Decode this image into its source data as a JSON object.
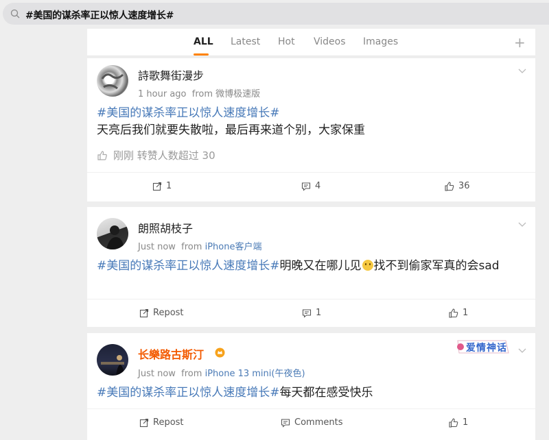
{
  "search": {
    "query": "#美国的谋杀率正以惊人速度增长#"
  },
  "tabs": [
    {
      "label": "ALL"
    },
    {
      "label": "Latest"
    },
    {
      "label": "Hot"
    },
    {
      "label": "Videos"
    },
    {
      "label": "Images"
    }
  ],
  "tab_add": "+",
  "posts": [
    {
      "author": "詩歌舞街漫步",
      "time": "1 hour ago",
      "from_label": "from",
      "source": "微博极速版",
      "hashtag": "#美国的谋杀率正以惊人速度增长#",
      "body": "天亮后我们就要失散啦，最后再来道个别，大家保重",
      "like_note": "刚刚 转赞人数超过 30",
      "repost": "1",
      "comments": "4",
      "likes": "36"
    },
    {
      "author": "朗照胡枝子",
      "time": "Just now",
      "from_label": "from",
      "source": "iPhone客户端",
      "hashtag": "#美国的谋杀率正以惊人速度增长#",
      "body_a": "明晚又在哪儿见",
      "body_b": "找不到偷家军真的会sad",
      "repost": "Repost",
      "comments": "1",
      "likes": "1"
    },
    {
      "author": "长樂路古斯汀",
      "time": "Just now",
      "from_label": "from",
      "source": "iPhone 13 mini(午夜色)",
      "hashtag": "#美国的谋杀率正以惊人速度增长#",
      "body": "每天都在感受快乐",
      "badge_text": "爱情神话",
      "repost": "Repost",
      "comments": "Comments",
      "likes": "1"
    }
  ],
  "colors": {
    "accent": "#ff8200",
    "link": "#4779b8",
    "vip_name": "#f35a00",
    "background": "#eeeeee"
  }
}
